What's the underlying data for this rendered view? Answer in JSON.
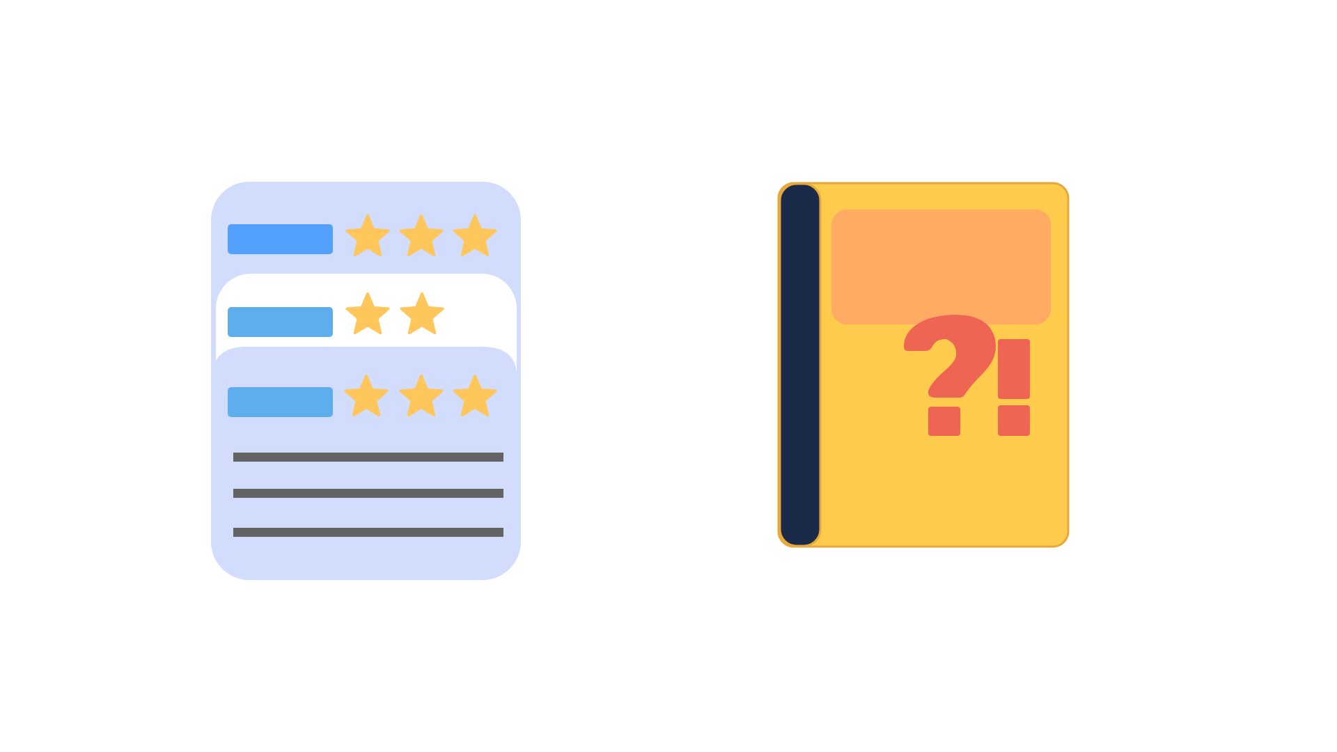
{
  "colors": {
    "background": "#ffffff",
    "card_light_blue": "#d2dcfc",
    "card_white": "#ffffff",
    "bar_blue_bright": "#53a1fc",
    "bar_blue": "#5eaded",
    "star": "#ffc75b",
    "text_line": "#636363",
    "book_cover": "#ffcb4d",
    "book_border": "#e6a83d",
    "book_spine": "#1b2a48",
    "book_label": "#ffab63",
    "symbol_red": "#ef6553"
  },
  "reviews": [
    {
      "rating": 3
    },
    {
      "rating": 2
    },
    {
      "rating": 3
    }
  ],
  "icons": {
    "review_card": "review-list-icon",
    "book": "question-book-icon",
    "question_mark": "question-mark-icon",
    "exclamation_mark": "exclamation-mark-icon"
  }
}
